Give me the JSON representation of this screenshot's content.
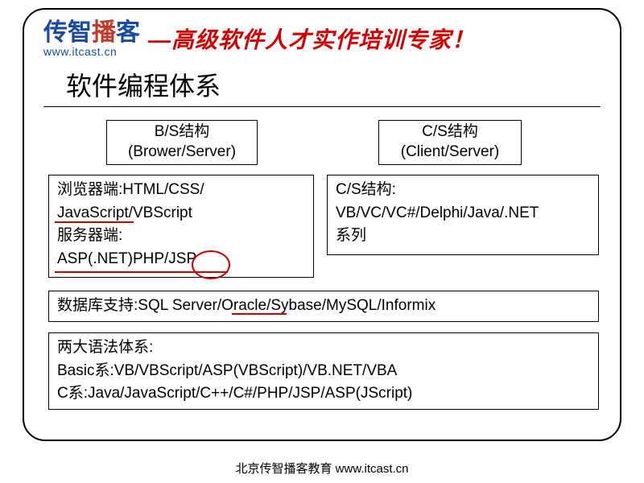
{
  "header": {
    "logo_chars": [
      "传",
      "智",
      "播",
      "客"
    ],
    "logo_url": "www.itcast.cn",
    "slogan": "—高级软件人才实作培训专家！"
  },
  "title": "软件编程体系",
  "bs_header": {
    "line1": "B/S结构",
    "line2": "(Brower/Server)"
  },
  "cs_header": {
    "line1": "C/S结构",
    "line2": "(Client/Server)"
  },
  "bs_body": {
    "browser_label": "浏览器端:",
    "browser_tech": "HTML/CSS/",
    "browser_tech2": "JavaScript/VBScript",
    "server_label": "服务器端:",
    "server_tech": "ASP(.NET)PHP/JSP"
  },
  "cs_body": {
    "label": "C/S结构:",
    "tech": "VB/VC/VC#/Delphi/Java/.NET",
    "suffix": "系列"
  },
  "db": {
    "label": "数据库支持:",
    "tech": "SQL Server/Oracle/Sybase/MySQL/Informix"
  },
  "syntax": {
    "label": "两大语法体系:",
    "basic": "Basic系:VB/VBScript/ASP(VBScript)/VB.NET/VBA",
    "c": "C系:Java/JavaScript/C++/C#/PHP/JSP/ASP(JScript)"
  },
  "footer": "北京传智播客教育 www.itcast.cn"
}
